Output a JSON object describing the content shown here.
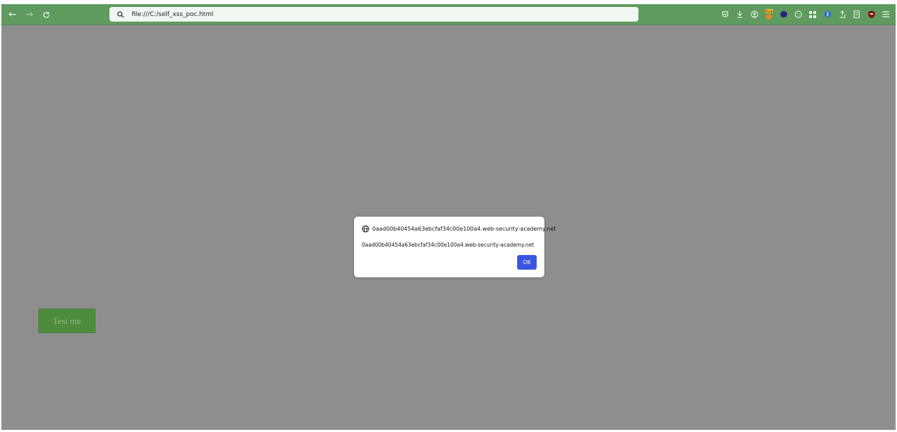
{
  "toolbar": {
    "back_icon": "arrow-left-icon",
    "forward_icon": "arrow-right-icon",
    "reload_icon": "reload-icon",
    "url": "file:///C:/self_xss_poc.html",
    "extensions": [
      {
        "name": "pocket-icon"
      },
      {
        "name": "download-icon"
      },
      {
        "name": "account-icon"
      },
      {
        "name": "burp-extension-icon",
        "label": "Burp"
      },
      {
        "name": "hexagon-extension-icon"
      },
      {
        "name": "cookie-extension-icon"
      },
      {
        "name": "grid-extension-icon"
      },
      {
        "name": "password-manager-icon"
      },
      {
        "name": "share-extension-icon"
      },
      {
        "name": "reader-extension-icon"
      },
      {
        "name": "ublock-icon"
      },
      {
        "name": "menu-icon"
      }
    ]
  },
  "page": {
    "test_button_label": "Test me"
  },
  "dialog": {
    "title": "0aad00b40454a63ebcfaf34c00e100a4.web-security-academy.net",
    "message": "0aad00b40454a63ebcfaf34c00e100a4.web-security-academy.net",
    "ok_label": "OK"
  },
  "colors": {
    "toolbar": "#5f9a5e",
    "overlay": "#8e8e8f",
    "ok_button": "#3a55e0",
    "test_button": "#4e8c3d"
  }
}
